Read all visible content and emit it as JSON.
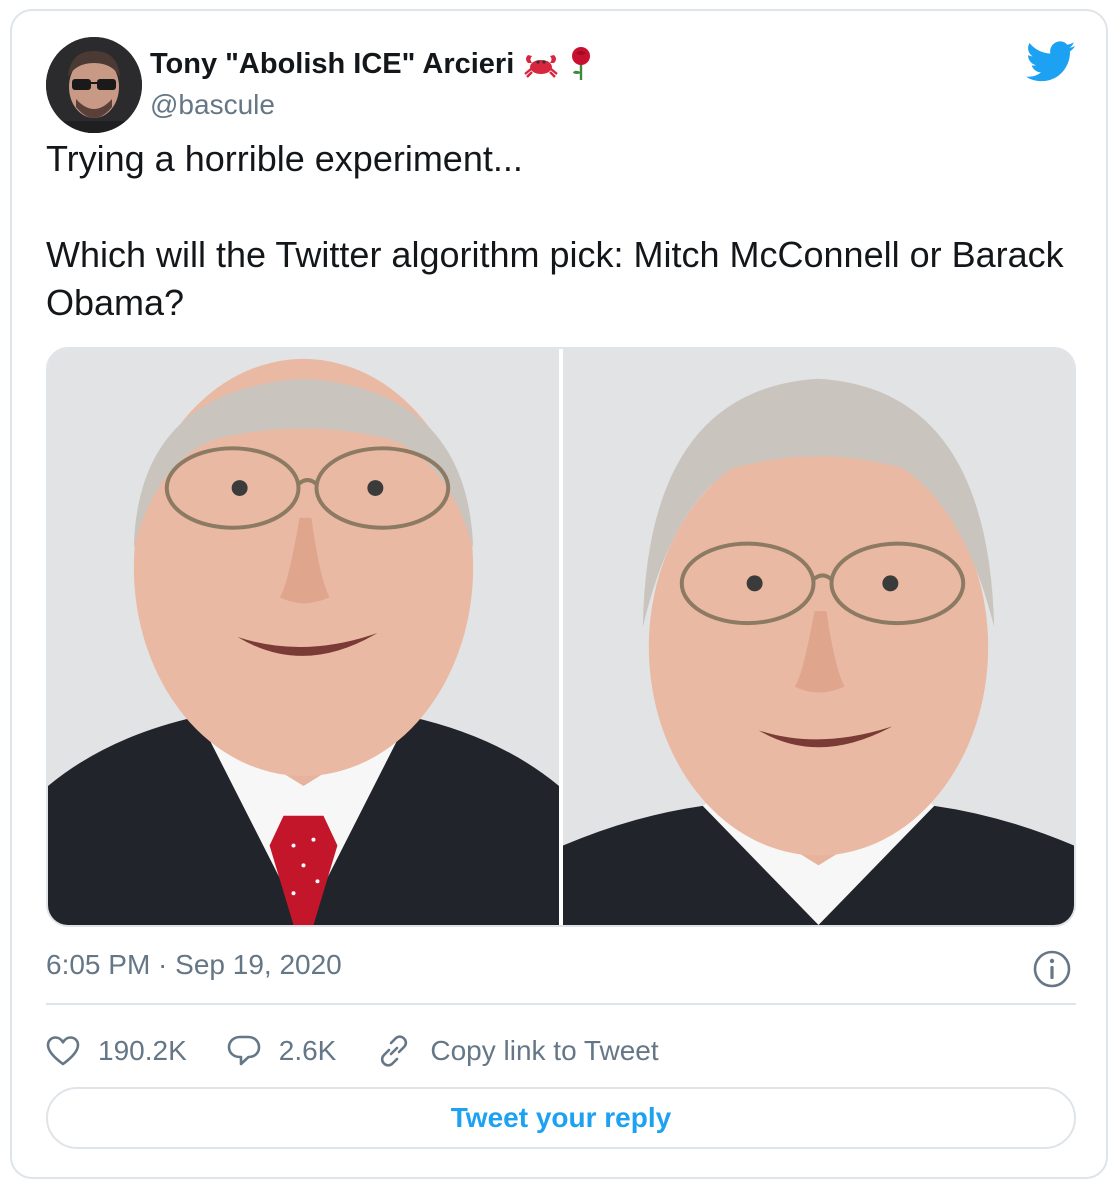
{
  "author": {
    "display_name": "Tony \"Abolish ICE\" Arcieri",
    "name_emojis": [
      "crab-emoji",
      "rose-emoji"
    ],
    "handle": "@bascule",
    "avatar_icon": "avatar"
  },
  "tweet": {
    "line1": "Trying a horrible experiment...",
    "line2": "Which will the Twitter algorithm pick: Mitch McConnell or Barack Obama?",
    "timestamp": "6:05 PM · Sep 19, 2020"
  },
  "media": {
    "images": [
      "portrait-photo",
      "portrait-photo"
    ]
  },
  "actions": {
    "likes": "190.2K",
    "replies": "2.6K",
    "copy_link": "Copy link to Tweet"
  },
  "reply_button": {
    "label": "Tweet your reply"
  },
  "colors": {
    "twitter_blue": "#1da1f2",
    "secondary_text": "#657786",
    "border": "#dfe4e9"
  }
}
